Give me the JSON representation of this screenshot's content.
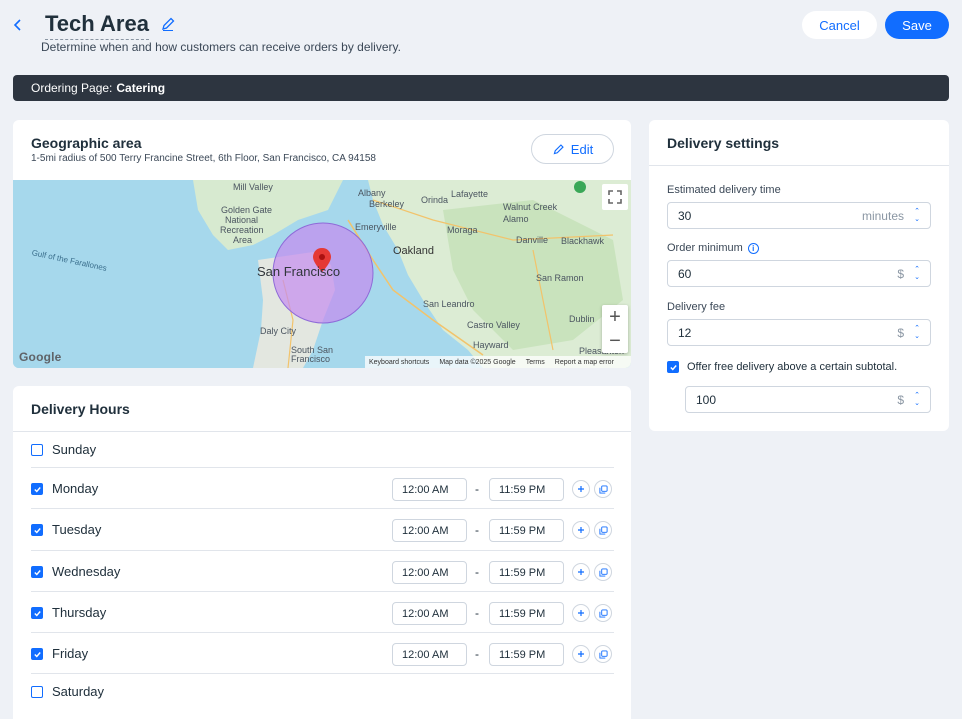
{
  "header": {
    "title": "Tech Area",
    "subtitle": "Determine when and how customers can receive orders by delivery.",
    "cancel_label": "Cancel",
    "save_label": "Save"
  },
  "banner": {
    "prefix": "Ordering Page:",
    "page_name": "Catering"
  },
  "geo": {
    "title": "Geographic area",
    "address": "1-5mi radius of 500 Terry Francine Street, 6th Floor, San Francisco, CA 94158",
    "edit_label": "Edit",
    "map": {
      "city": "San Francisco",
      "labels": [
        "Mill Valley",
        "Golden Gate",
        "National",
        "Recreation",
        "Area",
        "Albany",
        "Berkeley",
        "Emeryville",
        "Orinda",
        "Lafayette",
        "Walnut Creek",
        "Alamo",
        "Moraga",
        "Danville",
        "Blackhawk",
        "Oakland",
        "San Ramon",
        "San Leandro",
        "Castro Valley",
        "Dublin",
        "Daly City",
        "South San",
        "Francisco",
        "Hayward",
        "Pleasanton",
        "Gulf of the Farallones"
      ],
      "google": "Google",
      "footer": [
        "Keyboard shortcuts",
        "Map data ©2025 Google",
        "Terms",
        "Report a map error"
      ]
    }
  },
  "hours": {
    "title": "Delivery Hours",
    "days": [
      {
        "name": "Sunday",
        "enabled": false,
        "start": "",
        "end": ""
      },
      {
        "name": "Monday",
        "enabled": true,
        "start": "12:00 AM",
        "end": "11:59 PM"
      },
      {
        "name": "Tuesday",
        "enabled": true,
        "start": "12:00 AM",
        "end": "11:59 PM"
      },
      {
        "name": "Wednesday",
        "enabled": true,
        "start": "12:00 AM",
        "end": "11:59 PM"
      },
      {
        "name": "Thursday",
        "enabled": true,
        "start": "12:00 AM",
        "end": "11:59 PM"
      },
      {
        "name": "Friday",
        "enabled": true,
        "start": "12:00 AM",
        "end": "11:59 PM"
      },
      {
        "name": "Saturday",
        "enabled": false,
        "start": "",
        "end": ""
      }
    ],
    "separator": "-"
  },
  "settings": {
    "title": "Delivery settings",
    "est_time_label": "Estimated delivery time",
    "est_time_value": "30",
    "est_time_unit": "minutes",
    "order_min_label": "Order minimum",
    "order_min_value": "60",
    "delivery_fee_label": "Delivery fee",
    "delivery_fee_value": "12",
    "currency": "$",
    "free_delivery_label": "Offer free delivery above a certain subtotal.",
    "free_delivery_enabled": true,
    "free_delivery_value": "100"
  },
  "colors": {
    "accent": "#116dff",
    "background": "#eef1f6",
    "banner": "#2d3540",
    "radius_fill": "#c48cf0"
  }
}
